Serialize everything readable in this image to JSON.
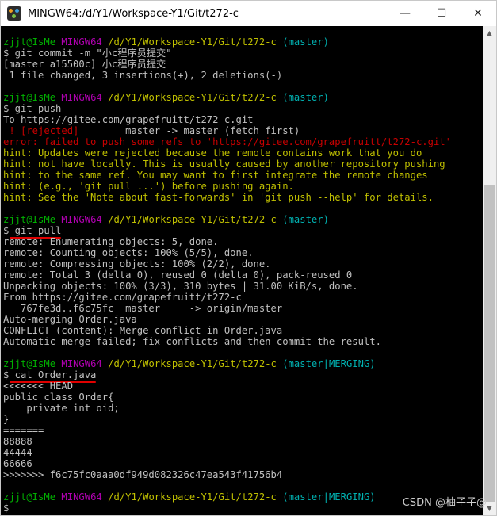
{
  "window": {
    "title": "MINGW64:/d/Y1/Workspace-Y1/Git/t272-c",
    "controls": {
      "minimize": "—",
      "maximize": "☐",
      "close": "✕"
    }
  },
  "colors": {
    "prompt_user": "#00b000",
    "prompt_host": "#b000b0",
    "prompt_path": "#c0c000",
    "prompt_branch": "#00b0b0",
    "error": "#c80000",
    "hint": "#c0c000",
    "annotation_underline": "#e00000"
  },
  "terminal": {
    "lines": [
      {
        "segments": [
          {
            "t": "zjjt@IsMe",
            "c": "green"
          },
          {
            "t": " ",
            "c": "white"
          },
          {
            "t": "MINGW64",
            "c": "magenta"
          },
          {
            "t": " ",
            "c": "white"
          },
          {
            "t": "/d/Y1/Workspace-Y1/Git/t272-c",
            "c": "yellow"
          },
          {
            "t": " ",
            "c": "white"
          },
          {
            "t": "(master)",
            "c": "cyan"
          }
        ]
      },
      {
        "segments": [
          {
            "t": "$ git commit -m \"小c程序员提交\"",
            "c": "white"
          }
        ]
      },
      {
        "segments": [
          {
            "t": "[master a15500c] 小c程序员提交",
            "c": "white"
          }
        ]
      },
      {
        "segments": [
          {
            "t": " 1 file changed, 3 insertions(+), 2 deletions(-)",
            "c": "white"
          }
        ]
      },
      {
        "segments": [
          {
            "t": "",
            "c": "white"
          }
        ]
      },
      {
        "segments": [
          {
            "t": "zjjt@IsMe",
            "c": "green"
          },
          {
            "t": " ",
            "c": "white"
          },
          {
            "t": "MINGW64",
            "c": "magenta"
          },
          {
            "t": " ",
            "c": "white"
          },
          {
            "t": "/d/Y1/Workspace-Y1/Git/t272-c",
            "c": "yellow"
          },
          {
            "t": " ",
            "c": "white"
          },
          {
            "t": "(master)",
            "c": "cyan"
          }
        ]
      },
      {
        "segments": [
          {
            "t": "$ git push",
            "c": "white"
          }
        ]
      },
      {
        "segments": [
          {
            "t": "To https://gitee.com/grapefruitt/t272-c.git",
            "c": "white"
          }
        ]
      },
      {
        "segments": [
          {
            "t": " ! [rejected]",
            "c": "red"
          },
          {
            "t": "        master -> master (fetch first)",
            "c": "white"
          }
        ]
      },
      {
        "segments": [
          {
            "t": "error: failed to push some refs to 'https://gitee.com/grapefruitt/t272-c.git'",
            "c": "red"
          }
        ]
      },
      {
        "segments": [
          {
            "t": "hint: Updates were rejected because the remote contains work that you do",
            "c": "yellow"
          }
        ]
      },
      {
        "segments": [
          {
            "t": "hint: not have locally. This is usually caused by another repository pushing",
            "c": "yellow"
          }
        ]
      },
      {
        "segments": [
          {
            "t": "hint: to the same ref. You may want to first integrate the remote changes",
            "c": "yellow"
          }
        ]
      },
      {
        "segments": [
          {
            "t": "hint: (e.g., 'git pull ...') before pushing again.",
            "c": "yellow"
          }
        ]
      },
      {
        "segments": [
          {
            "t": "hint: See the 'Note about fast-forwards' in 'git push --help' for details.",
            "c": "yellow"
          }
        ]
      },
      {
        "segments": [
          {
            "t": "",
            "c": "white"
          }
        ]
      },
      {
        "segments": [
          {
            "t": "zjjt@IsMe",
            "c": "green"
          },
          {
            "t": " ",
            "c": "white"
          },
          {
            "t": "MINGW64",
            "c": "magenta"
          },
          {
            "t": " ",
            "c": "white"
          },
          {
            "t": "/d/Y1/Workspace-Y1/Git/t272-c",
            "c": "yellow"
          },
          {
            "t": " ",
            "c": "white"
          },
          {
            "t": "(master)",
            "c": "cyan"
          }
        ]
      },
      {
        "segments": [
          {
            "t": "$ git pull",
            "c": "white"
          }
        ],
        "underline": true
      },
      {
        "segments": [
          {
            "t": "remote: Enumerating objects: 5, done.",
            "c": "white"
          }
        ]
      },
      {
        "segments": [
          {
            "t": "remote: Counting objects: 100% (5/5), done.",
            "c": "white"
          }
        ]
      },
      {
        "segments": [
          {
            "t": "remote: Compressing objects: 100% (2/2), done.",
            "c": "white"
          }
        ]
      },
      {
        "segments": [
          {
            "t": "remote: Total 3 (delta 0), reused 0 (delta 0), pack-reused 0",
            "c": "white"
          }
        ]
      },
      {
        "segments": [
          {
            "t": "Unpacking objects: 100% (3/3), 310 bytes | 31.00 KiB/s, done.",
            "c": "white"
          }
        ]
      },
      {
        "segments": [
          {
            "t": "From https://gitee.com/grapefruitt/t272-c",
            "c": "white"
          }
        ]
      },
      {
        "segments": [
          {
            "t": "   767fe3d..f6c75fc  master     -> origin/master",
            "c": "white"
          }
        ]
      },
      {
        "segments": [
          {
            "t": "Auto-merging Order.java",
            "c": "white"
          }
        ]
      },
      {
        "segments": [
          {
            "t": "CONFLICT (content): Merge conflict in Order.java",
            "c": "white"
          }
        ]
      },
      {
        "segments": [
          {
            "t": "Automatic merge failed; fix conflicts and then commit the result.",
            "c": "white"
          }
        ]
      },
      {
        "segments": [
          {
            "t": "",
            "c": "white"
          }
        ]
      },
      {
        "segments": [
          {
            "t": "zjjt@IsMe",
            "c": "green"
          },
          {
            "t": " ",
            "c": "white"
          },
          {
            "t": "MINGW64",
            "c": "magenta"
          },
          {
            "t": " ",
            "c": "white"
          },
          {
            "t": "/d/Y1/Workspace-Y1/Git/t272-c",
            "c": "yellow"
          },
          {
            "t": " ",
            "c": "white"
          },
          {
            "t": "(master|MERGING)",
            "c": "cyan"
          }
        ]
      },
      {
        "segments": [
          {
            "t": "$ cat Order.java",
            "c": "white"
          }
        ],
        "underline": true
      },
      {
        "segments": [
          {
            "t": "<<<<<<< HEAD",
            "c": "white"
          }
        ]
      },
      {
        "segments": [
          {
            "t": "public class Order{",
            "c": "white"
          }
        ]
      },
      {
        "segments": [
          {
            "t": "    private int oid;",
            "c": "white"
          }
        ]
      },
      {
        "segments": [
          {
            "t": "}",
            "c": "white"
          }
        ]
      },
      {
        "segments": [
          {
            "t": "=======",
            "c": "white"
          }
        ]
      },
      {
        "segments": [
          {
            "t": "88888",
            "c": "white"
          }
        ]
      },
      {
        "segments": [
          {
            "t": "44444",
            "c": "white"
          }
        ]
      },
      {
        "segments": [
          {
            "t": "66666",
            "c": "white"
          }
        ]
      },
      {
        "segments": [
          {
            "t": ">>>>>>> f6c75fc0aaa0df949d082326c47ea543f41756b4",
            "c": "white"
          }
        ]
      },
      {
        "segments": [
          {
            "t": "",
            "c": "white"
          }
        ]
      },
      {
        "segments": [
          {
            "t": "zjjt@IsMe",
            "c": "green"
          },
          {
            "t": " ",
            "c": "white"
          },
          {
            "t": "MINGW64",
            "c": "magenta"
          },
          {
            "t": " ",
            "c": "white"
          },
          {
            "t": "/d/Y1/Workspace-Y1/Git/t272-c",
            "c": "yellow"
          },
          {
            "t": " ",
            "c": "white"
          },
          {
            "t": "(master|MERGING)",
            "c": "cyan"
          }
        ]
      },
      {
        "segments": [
          {
            "t": "$",
            "c": "white"
          }
        ]
      }
    ]
  },
  "watermark": "CSDN @柚子子@"
}
